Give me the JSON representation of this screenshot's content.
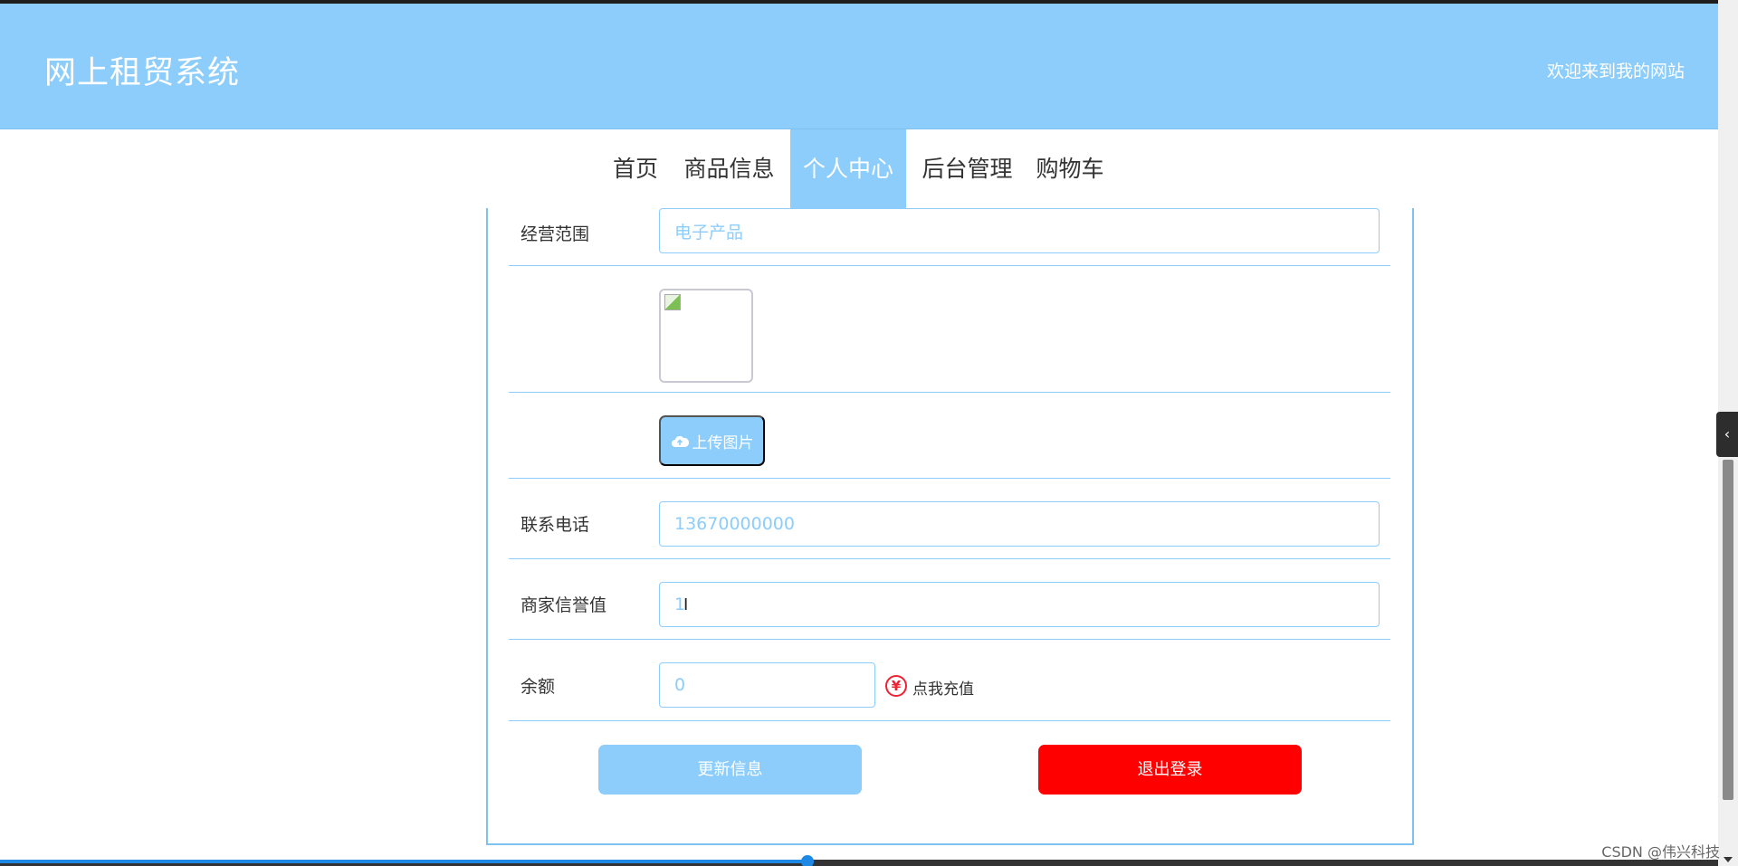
{
  "header": {
    "site_title": "网上租贸系统",
    "welcome": "欢迎来到我的网站"
  },
  "nav": {
    "items": [
      {
        "label": "首页"
      },
      {
        "label": "商品信息"
      },
      {
        "label": "个人中心",
        "active": true
      },
      {
        "label": "后台管理"
      },
      {
        "label": "购物车"
      }
    ]
  },
  "form": {
    "business_scope": {
      "label": "经营范围",
      "value": "电子产品"
    },
    "upload_label": "上传图片",
    "phone": {
      "label": "联系电话",
      "value": "13670000000"
    },
    "credit": {
      "label": "商家信誉值",
      "value": "1"
    },
    "balance": {
      "label": "余额",
      "value": "0",
      "recharge": "点我充值"
    }
  },
  "buttons": {
    "update": "更新信息",
    "logout": "退出登录"
  },
  "watermark": "CSDN @伟兴科技",
  "colors": {
    "accent": "#8dcdfb",
    "danger": "#ff0000"
  }
}
